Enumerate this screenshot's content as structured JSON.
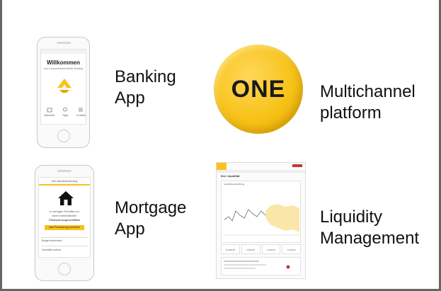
{
  "tiles": {
    "banking": {
      "label_line1": "Banking",
      "label_line2": "App",
      "screen": {
        "title": "Willkommen",
        "subtitle": "zum Commerzbank Mobile Banking",
        "tab1": "Übersicht",
        "tab2": "Tipps",
        "tab3": "In Arbeit",
        "logo_color": "#f9c21c"
      }
    },
    "multichannel": {
      "label_line1": "Multichannel",
      "label_line2": "platform",
      "coin_text": "ONE",
      "coin_color": "#f7c218"
    },
    "mortgage": {
      "label_line1": "Mortgage",
      "label_line2": "App",
      "screen": {
        "header": "Ihre Baufinanzierung",
        "text1": "In wenigen Schritten zu",
        "text2": "Ihrem verbindlichen",
        "text3": "Finanzierungszertifikat",
        "button": "Jetzt Finanzierung anfordern",
        "row1": "Budget berechnen",
        "row2": "Immobilie suchen"
      }
    },
    "liquidity": {
      "label_line1": "Liquidity",
      "label_line2": "Management",
      "screen": {
        "heading": "Ihre Liquidität",
        "chart_title": "Liquiditätsentwicklung",
        "box1": "10.000,00",
        "box2": "5.000,00",
        "box3": "2.000,00",
        "box4": "3.200,00"
      }
    }
  }
}
